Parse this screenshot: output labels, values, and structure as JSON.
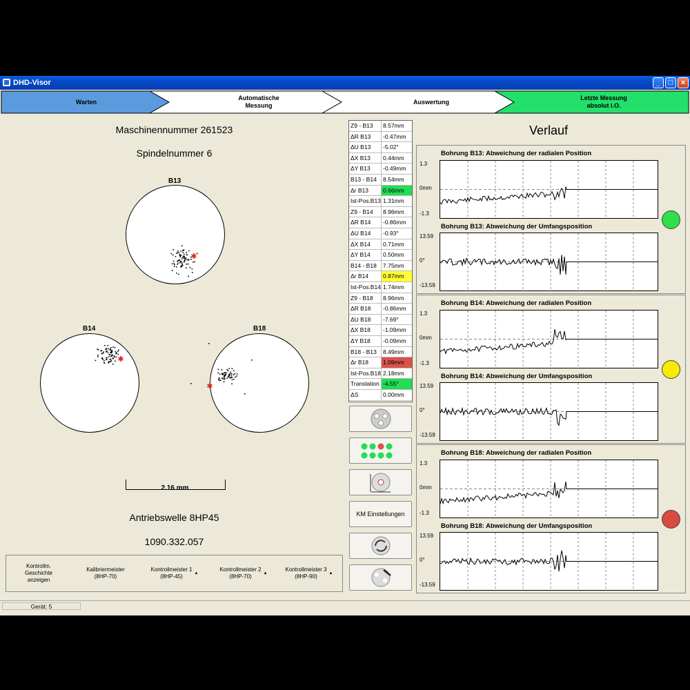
{
  "window": {
    "title": "DHD-Visor",
    "minimize": "_",
    "maximize": "□",
    "close": "×"
  },
  "steps": [
    {
      "label": "Warten",
      "color": "#5b9bdd"
    },
    {
      "label": "Automatische\nMessung",
      "color": "#ffffff"
    },
    {
      "label": "Auswertung",
      "color": "#ffffff"
    },
    {
      "label": "Letzte Messung\nabsolut i.O.",
      "color": "#22e06a"
    }
  ],
  "left": {
    "machine": "Maschinennummer 261523",
    "spindle": "Spindelnummer 6",
    "rings": {
      "b13": "B13",
      "b14": "B14",
      "b18": "B18"
    },
    "scale": "2.16 mm",
    "part": "Antriebswelle 8HP45",
    "number": "1090.332.057"
  },
  "masters": {
    "history": "Kontrollm.\nGeschichte\nanzeigen",
    "items": [
      {
        "label": "Kalibriermeister\n(8HP-70)",
        "caret": ""
      },
      {
        "label": "Kontrollmeister 1\n(8HP-45)",
        "caret": "▲"
      },
      {
        "label": "Kontrollmeister 2\n(8HP-70)",
        "caret": "▲"
      },
      {
        "label": "Kontrollmeister 3\n(8HP-90)",
        "caret": "▲"
      }
    ]
  },
  "measurements": [
    {
      "k": "Z9 - B13",
      "v": "8.57mm",
      "hl": ""
    },
    {
      "k": "ΔR B13",
      "v": "-0.47mm",
      "hl": ""
    },
    {
      "k": "ΔU B13",
      "v": "-5.02°",
      "hl": ""
    },
    {
      "k": "ΔX B13",
      "v": "0.44mm",
      "hl": ""
    },
    {
      "k": "ΔY B13",
      "v": "-0.49mm",
      "hl": ""
    },
    {
      "k": "B13 - B14",
      "v": "8.54mm",
      "hl": ""
    },
    {
      "k": "Δr B13",
      "v": "0.66mm",
      "hl": "#22dd55"
    },
    {
      "k": "Ist-Pos.B13",
      "v": "1.31mm",
      "hl": ""
    },
    {
      "k": "Z9 - B14",
      "v": "8.96mm",
      "hl": ""
    },
    {
      "k": "ΔR B14",
      "v": "-0.86mm",
      "hl": ""
    },
    {
      "k": "ΔU B14",
      "v": "-0.93°",
      "hl": ""
    },
    {
      "k": "ΔX B14",
      "v": "0.71mm",
      "hl": ""
    },
    {
      "k": "ΔY B14",
      "v": "0.50mm",
      "hl": ""
    },
    {
      "k": "B14 - B18",
      "v": "7.75mm",
      "hl": ""
    },
    {
      "k": "Δr B14",
      "v": "0.87mm",
      "hl": "#ffff33"
    },
    {
      "k": "Ist-Pos.B14",
      "v": "1.74mm",
      "hl": ""
    },
    {
      "k": "Z9 - B18",
      "v": "8.96mm",
      "hl": ""
    },
    {
      "k": "ΔR B18",
      "v": "-0.86mm",
      "hl": ""
    },
    {
      "k": "ΔU B18",
      "v": "-7.69°",
      "hl": ""
    },
    {
      "k": "ΔX B18",
      "v": "-1.09mm",
      "hl": ""
    },
    {
      "k": "ΔY B18",
      "v": "-0.09mm",
      "hl": ""
    },
    {
      "k": "B18 - B13",
      "v": "8.49mm",
      "hl": ""
    },
    {
      "k": "Δr B18",
      "v": "1.09mm",
      "hl": "#d9534a"
    },
    {
      "k": "Ist-Pos.B18",
      "v": "2.18mm",
      "hl": ""
    },
    {
      "k": "Translation",
      "v": "-4.55°",
      "hl": "#22dd55"
    },
    {
      "k": "ΔS",
      "v": "0.00mm",
      "hl": ""
    }
  ],
  "tools": {
    "km_settings": "KM Einstellungen"
  },
  "verlauf": "Verlauf",
  "charts": [
    {
      "title": "Bohrung B13: Abweichung der radialen Position",
      "ytop": "1.3",
      "ymid": "0mm",
      "ybot": "-1.3",
      "variant": "radial"
    },
    {
      "title": "Bohrung B13: Abweichung der Umfangsposition",
      "ytop": "13.59",
      "ymid": "0°",
      "ybot": "-13.59",
      "variant": "umfang"
    },
    {
      "title": "Bohrung B14: Abweichung der radialen Position",
      "ytop": "1.3",
      "ymid": "0mm",
      "ybot": "-1.3",
      "variant": "radial"
    },
    {
      "title": "Bohrung B14: Abweichung der Umfangsposition",
      "ytop": "13.59",
      "ymid": "0°",
      "ybot": "-13.59",
      "variant": "umfang"
    },
    {
      "title": "Bohrung B18: Abweichung der radialen Position",
      "ytop": "1.3",
      "ymid": "0mm",
      "ybot": "-1.3",
      "variant": "radial"
    },
    {
      "title": "Bohrung B18: Abweichung der Umfangsposition",
      "ytop": "13.59",
      "ymid": "0°",
      "ybot": "-13.59",
      "variant": "umfang"
    }
  ],
  "status_leds": [
    {
      "bore": "B13",
      "color": "#2ee04a"
    },
    {
      "bore": "B14",
      "color": "#f6ec00"
    },
    {
      "bore": "B18",
      "color": "#d94a40"
    }
  ],
  "status": "Gerät: 5"
}
